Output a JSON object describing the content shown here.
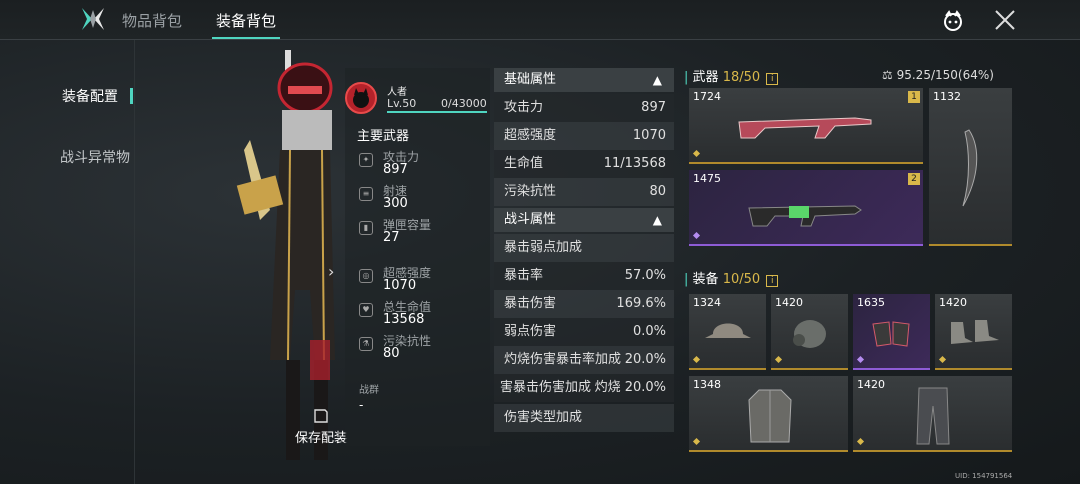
{
  "tabs": [
    {
      "label": "物品背包"
    },
    {
      "label": "装备背包"
    }
  ],
  "sidebar": {
    "items": [
      {
        "label": "装备配置"
      },
      {
        "label": "战斗异常物"
      }
    ]
  },
  "player": {
    "name": "人者",
    "level": "Lv.50",
    "exp": "0/43000"
  },
  "main_weapon": {
    "title": "主要武器",
    "stats": [
      {
        "label": "攻击力",
        "value": "897",
        "icon": "attack-icon"
      },
      {
        "label": "射速",
        "value": "300",
        "icon": "fire-rate-icon"
      },
      {
        "label": "弹匣容量",
        "value": "27",
        "icon": "magazine-icon"
      },
      {
        "label": "超感强度",
        "value": "1070",
        "icon": "psi-icon"
      },
      {
        "label": "总生命值",
        "value": "13568",
        "icon": "heart-icon"
      },
      {
        "label": "污染抗性",
        "value": "80",
        "icon": "resist-icon"
      }
    ],
    "troop_label": "战群",
    "troop_value": "-"
  },
  "save_button": "保存配装",
  "basic_attrs": {
    "title": "基础属性",
    "rows": [
      {
        "label": "攻击力",
        "value": "897"
      },
      {
        "label": "超感强度",
        "value": "1070"
      },
      {
        "label": "生命值",
        "value": "11/13568"
      },
      {
        "label": "污染抗性",
        "value": "80"
      }
    ]
  },
  "combat_attrs": {
    "title": "战斗属性",
    "rows": [
      {
        "label": "暴击弱点加成",
        "value": ""
      },
      {
        "label": "暴击率",
        "value": "57.0%"
      },
      {
        "label": "暴击伤害",
        "value": "169.6%"
      },
      {
        "label": "弱点伤害",
        "value": "0.0%"
      },
      {
        "label": "灼烧伤害暴击率加成",
        "value": "20.0%"
      },
      {
        "label": "害暴击伤害加成",
        "value": "灼烧 20.0%"
      },
      {
        "label": "伤害类型加成",
        "value": ""
      }
    ]
  },
  "weapons": {
    "label": "武器",
    "count": "18/50",
    "items": [
      {
        "num": "1724",
        "slot": "1"
      },
      {
        "num": "1475",
        "slot": "2"
      },
      {
        "num": "1132",
        "slot": ""
      }
    ]
  },
  "gear": {
    "label": "装备",
    "count": "10/50",
    "items": [
      {
        "num": "1324"
      },
      {
        "num": "1420"
      },
      {
        "num": "1635"
      },
      {
        "num": "1420"
      },
      {
        "num": "1348"
      },
      {
        "num": "1420"
      }
    ]
  },
  "weight": "95.25/150(64%)",
  "uid": "UID: 154791564",
  "colors": {
    "accent": "#4fd5c0",
    "gold": "#d9b84a",
    "purple": "#8e5cd6"
  }
}
